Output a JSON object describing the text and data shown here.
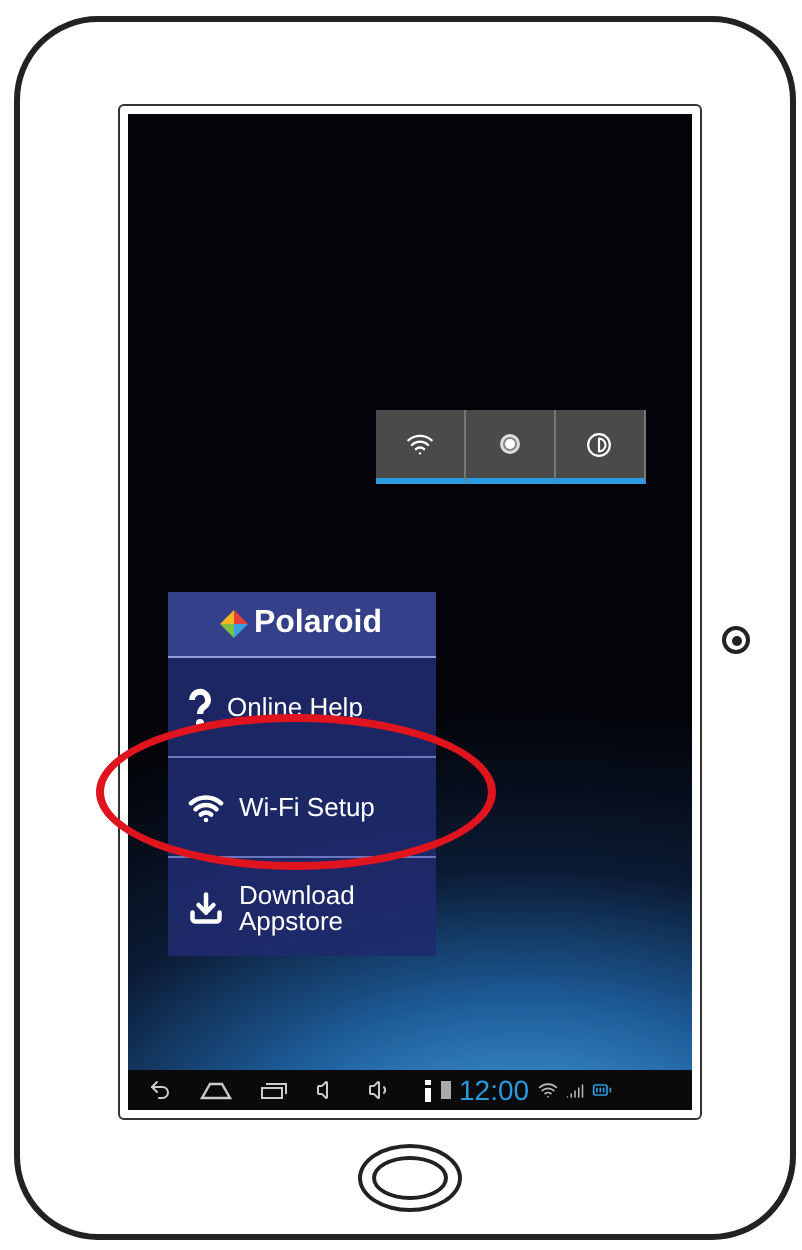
{
  "quick_toggles": [
    {
      "kind": "wifi",
      "on": true
    },
    {
      "kind": "ring",
      "on": true
    },
    {
      "kind": "contrast",
      "on": true
    }
  ],
  "menu": {
    "brand": "Polaroid",
    "items": [
      {
        "kind": "help",
        "label": "Online Help",
        "highlighted": false
      },
      {
        "kind": "wifi",
        "label": "Wi-Fi Setup",
        "highlighted": true
      },
      {
        "kind": "download",
        "label": "Download Appstore",
        "highlighted": false
      }
    ]
  },
  "status_bar": {
    "time": "12:00"
  }
}
